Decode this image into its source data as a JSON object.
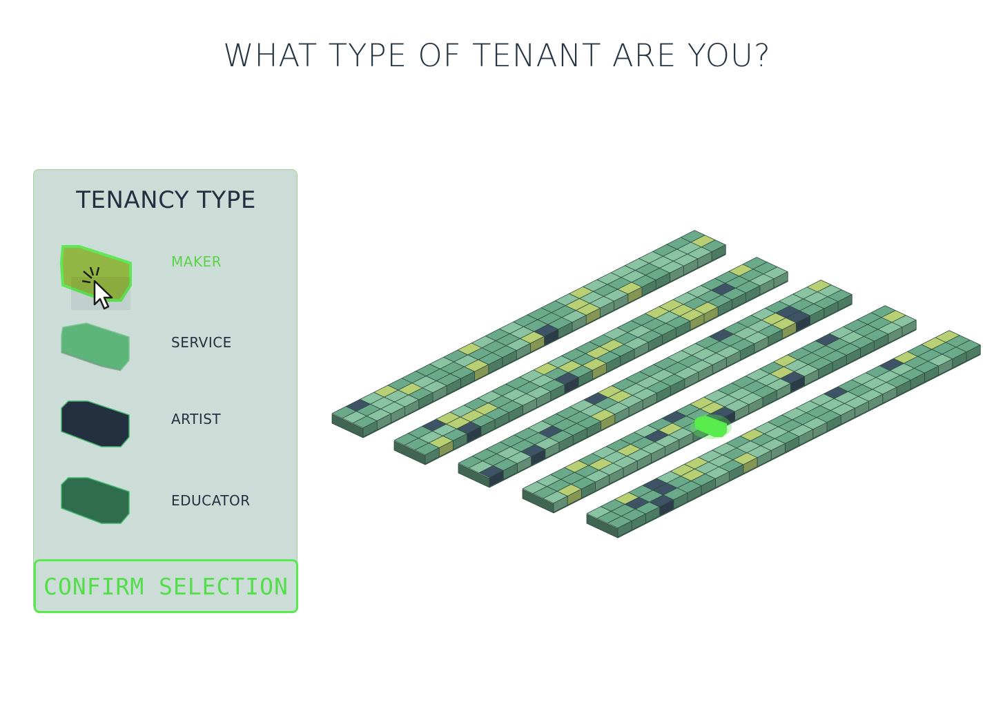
{
  "page": {
    "title": "WHAT TYPE OF TENANT ARE YOU?"
  },
  "panel": {
    "title": "TENANCY TYPE",
    "options": [
      {
        "label": "MAKER",
        "color": "#8fb43c",
        "selected": true
      },
      {
        "label": "SERVICE",
        "color": "#5eb57a",
        "selected": false
      },
      {
        "label": "ARTIST",
        "color": "#233040",
        "selected": false
      },
      {
        "label": "EDUCATOR",
        "color": "#306c4e",
        "selected": false
      }
    ],
    "confirm_label": "CONFIRM SELECTION"
  },
  "map": {
    "strips": 5,
    "palette": {
      "base": "#6aa98a",
      "light": "#89c3a2",
      "yellow": "#b9cf74",
      "navy": "#3e5466",
      "highlight": "#58ec4c",
      "outline": "#2e4a3e",
      "selected_border": "#5ae84f"
    }
  }
}
